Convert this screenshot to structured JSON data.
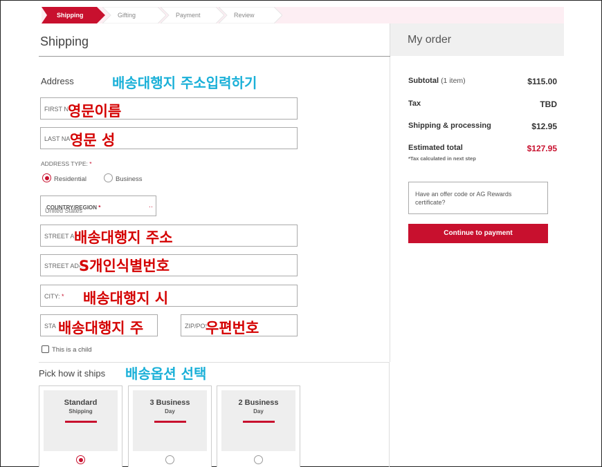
{
  "steps": [
    {
      "label": "Shipping",
      "active": true
    },
    {
      "label": "Gifting",
      "active": false
    },
    {
      "label": "Payment",
      "active": false
    },
    {
      "label": "Review",
      "active": false
    }
  ],
  "colors": {
    "accent": "#c8102e",
    "step_bg": "#fdeef3",
    "annotation_red": "#d40000",
    "annotation_blue": "#1ab0d8"
  },
  "shipping": {
    "title": "Shipping",
    "address_label": "Address",
    "fields": {
      "first_name": "FIRST NA",
      "last_name": "LAST NA",
      "country_label": "COUNTRY/REGION",
      "country_value": "United States",
      "street": "STREET A",
      "street2": "STREET ADDR",
      "city": "CITY:",
      "state": "STA",
      "zip": "ZIP/POS"
    },
    "required_mark": "*",
    "address_type_label": "ADDRESS TYPE:",
    "address_types": [
      "Residential",
      "Business"
    ],
    "child_label": "This is a child"
  },
  "ships": {
    "label": "Pick how it ships",
    "options": [
      {
        "line1": "Standard",
        "line2": "Shipping",
        "selected": true
      },
      {
        "line1": "3 Business",
        "line2": "Day",
        "selected": false
      },
      {
        "line1": "2 Business",
        "line2": "Day",
        "selected": false
      }
    ]
  },
  "order": {
    "title": "My order",
    "subtotal_label": "Subtotal",
    "subtotal_items": "(1 item)",
    "subtotal_value": "$115.00",
    "tax_label": "Tax",
    "tax_value": "TBD",
    "shipping_label": "Shipping & processing",
    "shipping_value": "$12.95",
    "total_label": "Estimated total",
    "total_value": "$127.95",
    "tax_note": "*Tax calculated in next step",
    "offer_placeholder": "Have an offer code or AG Rewards certificate?",
    "pay_button": "Continue to payment"
  },
  "annotations": {
    "address_heading": "배송대행지 주소입력하기",
    "first_name": "영문이름",
    "last_name": "영문 성",
    "street": "배송대행지 주소",
    "street2": "S개인식별번호",
    "city": "배송대행지 시",
    "state": "배송대행지 주",
    "zip": "우편번호",
    "ship_option": "배송옵션 선택"
  }
}
